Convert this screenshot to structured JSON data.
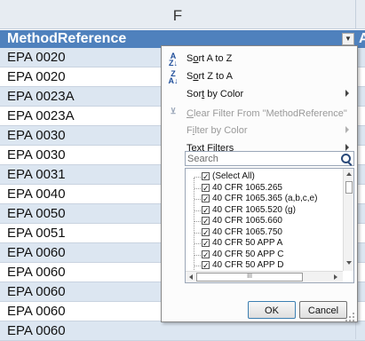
{
  "column": {
    "letter": "F"
  },
  "header": {
    "label": "MethodReference",
    "next_col_fragment": "A"
  },
  "rows": [
    "EPA 0020",
    "EPA 0020",
    "EPA 0023A",
    "EPA 0023A",
    "EPA 0030",
    "EPA 0030",
    "EPA 0031",
    "EPA 0040",
    "EPA 0050",
    "EPA 0051",
    "EPA 0060",
    "EPA 0060",
    "EPA 0060",
    "EPA 0060",
    "EPA 0060"
  ],
  "filter_menu": {
    "items": [
      {
        "label": "Sort A to Z",
        "icon": "sort-az-icon",
        "glyph": "A\nZ↓",
        "enabled": true,
        "submenu": false
      },
      {
        "label": "Sort Z to A",
        "icon": "sort-za-icon",
        "glyph": "Z\nA↓",
        "enabled": true,
        "submenu": false
      },
      {
        "label": "Sort by Color",
        "icon": "",
        "glyph": "",
        "enabled": true,
        "submenu": true
      },
      {
        "label": "Clear Filter From \"MethodReference\"",
        "icon": "clear-filter-icon",
        "glyph": "⊻",
        "enabled": false,
        "submenu": false
      },
      {
        "label": "Filter by Color",
        "icon": "",
        "glyph": "",
        "enabled": false,
        "submenu": true
      },
      {
        "label": "Text Filters",
        "icon": "",
        "glyph": "",
        "enabled": true,
        "submenu": true
      }
    ],
    "search_placeholder": "Search",
    "list": [
      {
        "label": "(Select All)",
        "checked": true
      },
      {
        "label": "40 CFR 1065.265",
        "checked": true
      },
      {
        "label": "40 CFR 1065.365 (a,b,c,e)",
        "checked": true
      },
      {
        "label": "40 CFR 1065.520 (g)",
        "checked": true
      },
      {
        "label": "40 CFR 1065.660",
        "checked": true
      },
      {
        "label": "40 CFR 1065.750",
        "checked": true
      },
      {
        "label": "40 CFR 50 APP A",
        "checked": true
      },
      {
        "label": "40 CFR 50 APP C",
        "checked": true
      },
      {
        "label": "40 CFR 50 APP D",
        "checked": true
      }
    ],
    "ok_label": "OK",
    "cancel_label": "Cancel"
  }
}
